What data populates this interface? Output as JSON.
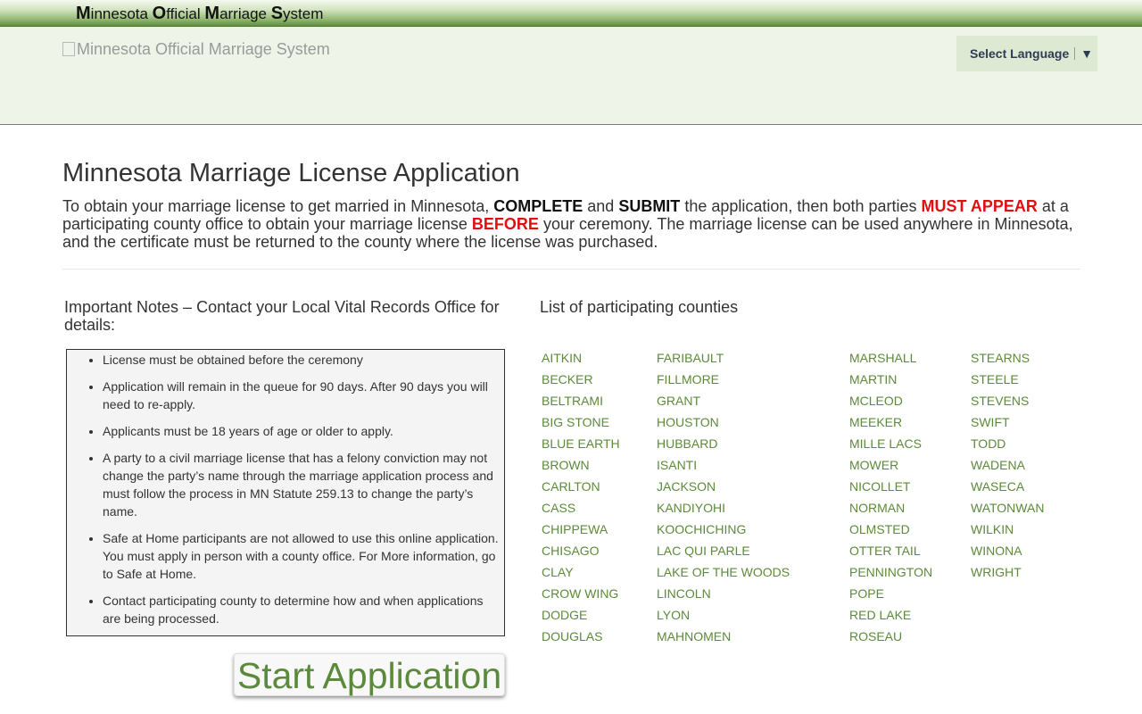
{
  "topbar": {
    "title_parts": [
      {
        "initial": "M",
        "rest": "innesota "
      },
      {
        "initial": "O",
        "rest": "fficial "
      },
      {
        "initial": "M",
        "rest": "arriage "
      },
      {
        "initial": "S",
        "rest": "ystem"
      }
    ]
  },
  "header": {
    "logo_alt": "Minnesota Official Marriage System",
    "language_label": "Select Language",
    "language_arrow": "▼"
  },
  "main": {
    "title": "Minnesota Marriage License Application",
    "intro": [
      {
        "text": "To obtain your marriage license to get married in Minnesota, ",
        "style": "normal"
      },
      {
        "text": "COMPLETE",
        "style": "bold"
      },
      {
        "text": " and ",
        "style": "normal"
      },
      {
        "text": "SUBMIT",
        "style": "bold"
      },
      {
        "text": " the application, then both parties ",
        "style": "normal"
      },
      {
        "text": "MUST APPEAR",
        "style": "red"
      },
      {
        "text": " at a participating county office to obtain your marriage license ",
        "style": "normal"
      },
      {
        "text": "BEFORE",
        "style": "red"
      },
      {
        "text": " your ceremony. The marriage license can be used anywhere in Minnesota, and the certificate must be returned to the county where the license was purchased.",
        "style": "normal"
      }
    ],
    "notes_title": "Important Notes – Contact your Local Vital Records Office for details:",
    "notes": [
      "License must be obtained before the ceremony",
      "Application will remain in the queue for 90 days. After 90 days you will need to re-apply.",
      "Applicants must be 18 years of age or older to apply.",
      "A party to a civil marriage license that has a felony conviction may not change the party’s name through the marriage application process and must follow the process in MN Statute 259.13 to change the party’s name.",
      "Safe at Home participants are not allowed to use this online application. You must apply in person with a county office. For More information, go to Safe at Home.",
      "Contact participating county to determine how and when applications are being processed."
    ],
    "start_button": "Start Application",
    "counties_title": "List of participating counties",
    "counties": [
      [
        "AITKIN",
        "BECKER",
        "BELTRAMI",
        "BIG STONE",
        "BLUE EARTH",
        "BROWN",
        "CARLTON",
        "CASS",
        "CHIPPEWA",
        "CHISAGO",
        "CLAY",
        "CROW WING",
        "DODGE",
        "DOUGLAS"
      ],
      [
        "FARIBAULT",
        "FILLMORE",
        "GRANT",
        "HOUSTON",
        "HUBBARD",
        "ISANTI",
        "JACKSON",
        "KANDIYOHI",
        "KOOCHICHING",
        "LAC QUI PARLE",
        "LAKE OF THE WOODS",
        "LINCOLN",
        "LYON",
        "MAHNOMEN"
      ],
      [
        "MARSHALL",
        "MARTIN",
        "MCLEOD",
        "MEEKER",
        "MILLE LACS",
        "MOWER",
        "NICOLLET",
        "NORMAN",
        "OLMSTED",
        "OTTER TAIL",
        "PENNINGTON",
        "POPE",
        "RED LAKE",
        "ROSEAU"
      ],
      [
        "STEARNS",
        "STEELE",
        "STEVENS",
        "SWIFT",
        "TODD",
        "WADENA",
        "WASECA",
        "WATONWAN",
        "WILKIN",
        "WINONA",
        "WRIGHT"
      ]
    ]
  },
  "colors": {
    "link_green": "#5c8a3a",
    "alert_red": "#e01010",
    "header_bg": "#eef5e8"
  }
}
